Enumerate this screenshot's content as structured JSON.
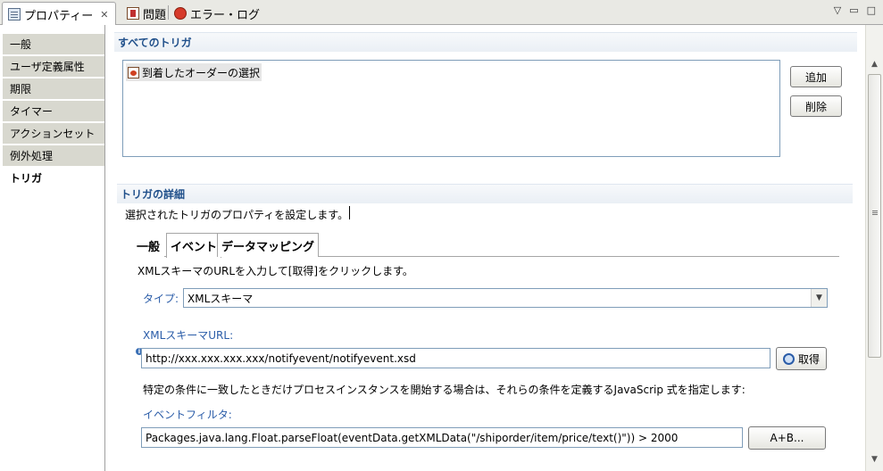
{
  "tabs": [
    {
      "label": "プロパティー",
      "icon": "properties-icon",
      "close": "✕"
    },
    {
      "label": "問題",
      "icon": "problems-icon"
    },
    {
      "label": "エラー・ログ",
      "icon": "error-log-icon"
    }
  ],
  "view_controls": {
    "menu": "▽",
    "minimize": "▭",
    "maximize": "□"
  },
  "nav": {
    "items": [
      "一般",
      "ユーザ定義属性",
      "期限",
      "タイマー",
      "アクションセット",
      "例外処理",
      "トリガ"
    ],
    "active": "トリガ"
  },
  "all_triggers": {
    "title": "すべてのトリガ",
    "items": [
      "到着したオーダーの選択"
    ],
    "add_label": "追加",
    "delete_label": "削除"
  },
  "details": {
    "title": "トリガの詳細",
    "description": "選択されたトリガのプロパティを設定します。",
    "tabs": [
      "一般",
      "イベント",
      "データマッピング"
    ],
    "active_tab": "イベント",
    "instruction": "XMLスキーマのURLを入力して[取得]をクリックします。",
    "type_label": "タイプ:",
    "type_value": "XMLスキーマ",
    "url_label": "XMLスキーマURL:",
    "url_value": "http://xxx.xxx.xxx.xxx/notifyevent/notifyevent.xsd",
    "fetch_label": "取得",
    "filter_instruction": "特定の条件に一致したときだけプロセスインスタンスを開始する場合は、それらの条件を定義するJavaScrip 式を指定します:",
    "filter_label": "イベントフィルタ:",
    "filter_value": "Packages.java.lang.Float.parseFloat(eventData.getXMLData(\"/shiporder/item/price/text()\")) > 2000",
    "expr_button": "A+B..."
  },
  "colors": {
    "accent": "#1f4f8a",
    "label": "#2a5ca8",
    "nav_bg": "#d8d8cf"
  }
}
